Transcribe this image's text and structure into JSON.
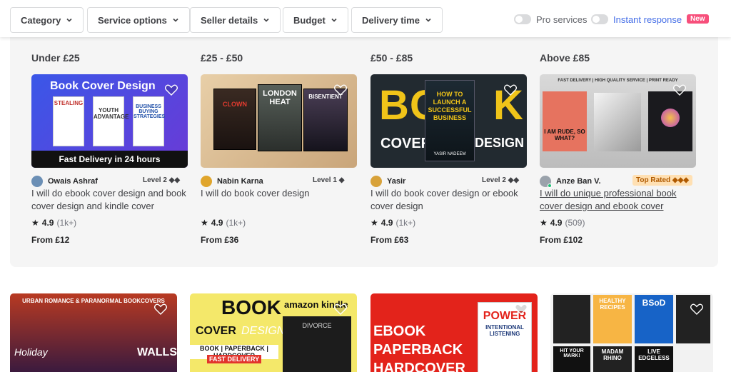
{
  "filters": {
    "category": "Category",
    "service_options": "Service options",
    "seller_details": "Seller details",
    "budget": "Budget",
    "delivery_time": "Delivery time"
  },
  "toggles": {
    "pro_services": "Pro services",
    "instant_response": "Instant response",
    "new_badge": "New"
  },
  "budget_buckets": [
    {
      "label": "Under £25",
      "thumb_text": {
        "title": "Book Cover Design",
        "banner": "Fast Delivery in 24 hours",
        "b1": "STEALING",
        "b2": "YOUTH ADVANTAGE",
        "b3": "BUSINESS BUYING STRATEGIES"
      },
      "seller": "Owais Ashraf",
      "level": "Level 2 ◆◆",
      "title": "I will do ebook cover design and book cover design and kindle cover",
      "rating": "4.9",
      "reviews": "(1k+)",
      "price": "From £12"
    },
    {
      "label": "£25 - £50",
      "thumb_text": {
        "b1": "CLOWN",
        "b2": "LONDON HEAT",
        "b3": "BISENTIENT"
      },
      "seller": "Nabin Karna",
      "level": "Level 1 ◆",
      "title": "I will do book cover design",
      "rating": "4.9",
      "reviews": "(1k+)",
      "price": "From £36"
    },
    {
      "label": "£50 - £85",
      "thumb_text": {
        "left": "BOO",
        "right": "K",
        "cover": "COVER",
        "design": "DESIGN",
        "book": "HOW TO LAUNCH A SUCCESSFUL BUSINESS",
        "author": "YASIR NADEEM"
      },
      "seller": "Yasir",
      "level": "Level 2 ◆◆",
      "title": "I will do book cover design or ebook cover design",
      "rating": "4.9",
      "reviews": "(1k+)",
      "price": "From £63"
    },
    {
      "label": "Above £85",
      "thumb_text": {
        "top": "FAST DELIVERY | HIGH QUALITY SERVICE | PRINT READY",
        "b1": "I AM RUDE, SO WHAT?"
      },
      "seller": "Anze Ban V.",
      "level": "Top Rated ◆◆◆",
      "title": "I will do unique professional book cover design and ebook cover",
      "rating": "4.9",
      "reviews": "(509)",
      "price": "From £102"
    }
  ],
  "more_gigs": [
    {
      "top": "URBAN ROMANCE & PARANORMAL BOOKCOVERS",
      "t1": "Holiday",
      "t2": "WALLS"
    },
    {
      "t1": "BOOK",
      "t2": "COVER",
      "t3": "DESIGN",
      "t4": "BOOK | PAPERBACK | HARDCOVER",
      "t5": "FAST DELIVERY",
      "t6": "amazon kindle",
      "t7": "DIVORCE"
    },
    {
      "t1": "EBOOK",
      "t2": "PAPERBACK",
      "t3": "HARDCOVER",
      "t4": "POWER",
      "t5": "INTENTIONAL LISTENING"
    },
    {
      "t1": "HEALTHY RECIPES",
      "t2": "BSoD",
      "t3": "HIT YOUR MARK!",
      "t4": "MADAM RHINO",
      "t5": "LIVE EDGELESS"
    }
  ],
  "colors": {
    "accent": "#1dbf73",
    "link": "#446ee7",
    "badge": "#f74f7b"
  }
}
